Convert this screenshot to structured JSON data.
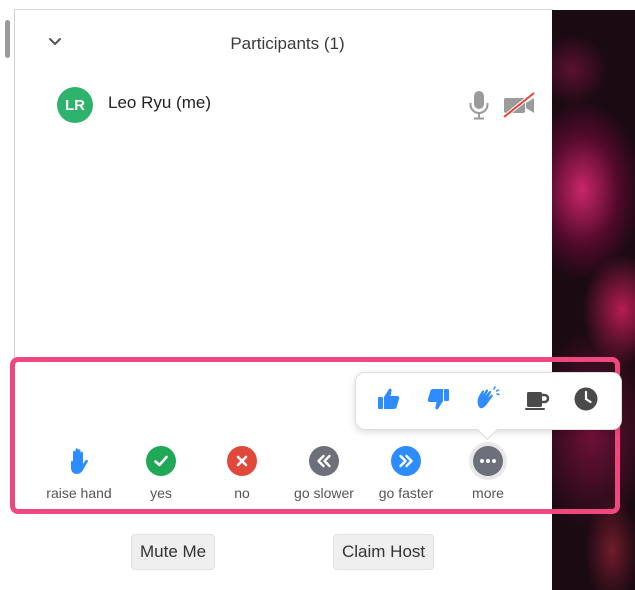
{
  "panel": {
    "title": "Participants (1)"
  },
  "participants": [
    {
      "initials": "LR",
      "name": "Leo Ryu (me)",
      "avatar_color": "#2db36b"
    }
  ],
  "reactions_popover": {
    "icons": [
      "thumbs-up-icon",
      "thumbs-down-icon",
      "clapping-hands-icon",
      "coffee-cup-icon",
      "clock-icon"
    ]
  },
  "feedback": [
    {
      "label": "raise hand",
      "icon": "raise-hand-icon",
      "color": "#2d8cff"
    },
    {
      "label": "yes",
      "icon": "checkmark-icon",
      "color": "#1fa855"
    },
    {
      "label": "no",
      "icon": "x-icon",
      "color": "#e0483a"
    },
    {
      "label": "go slower",
      "icon": "rewind-icon",
      "color": "#6d6f7b"
    },
    {
      "label": "go faster",
      "icon": "fast-forward-icon",
      "color": "#2d8cff"
    },
    {
      "label": "more",
      "icon": "ellipsis-icon",
      "color": "#6d6f7b"
    }
  ],
  "actions": {
    "mute_me": "Mute Me",
    "claim_host": "Claim Host"
  },
  "colors": {
    "highlight": "#f0487e",
    "accent_blue": "#2d8cff"
  }
}
